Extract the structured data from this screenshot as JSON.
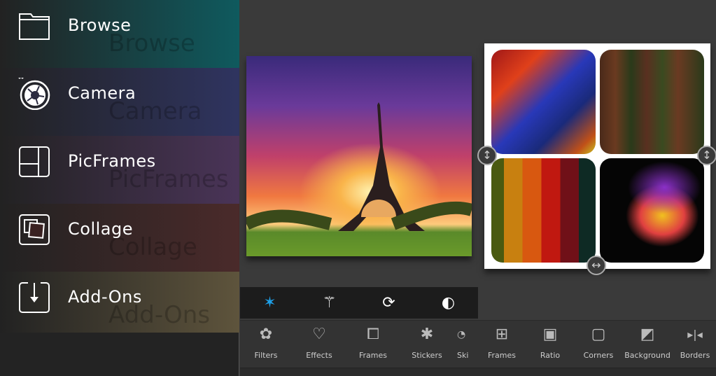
{
  "sidebar": {
    "items": [
      {
        "label": "Browse",
        "icon": "folder-icon",
        "color": "#0f5a5e"
      },
      {
        "label": "Camera",
        "icon": "camera-aperture-icon",
        "color": "#2f3460"
      },
      {
        "label": "PicFrames",
        "icon": "picframes-icon",
        "color": "#4a3458"
      },
      {
        "label": "Collage",
        "icon": "collage-icon",
        "color": "#4a2a2a"
      },
      {
        "label": "Add-Ons",
        "icon": "download-icon",
        "color": "#5e543c"
      }
    ]
  },
  "toolstrip": {
    "items": [
      {
        "icon": "sparkles-icon",
        "color": "#1ea0e8"
      },
      {
        "icon": "magic-wand-icon"
      },
      {
        "icon": "rotate-icon"
      },
      {
        "icon": "brightness-contrast-icon"
      }
    ]
  },
  "toolbar": {
    "items": [
      {
        "label": "Filters",
        "icon": "flower-icon"
      },
      {
        "label": "Effects",
        "icon": "heart-icon"
      },
      {
        "label": "Frames",
        "icon": "frame-star-icon"
      },
      {
        "label": "Stickers",
        "icon": "splat-icon"
      },
      {
        "label": "Ski",
        "icon": "sketch-icon"
      },
      {
        "label": "Frames",
        "icon": "picframes-icon"
      },
      {
        "label": "Ratio",
        "icon": "ratio-icon"
      },
      {
        "label": "Corners",
        "icon": "rounded-square-icon"
      },
      {
        "label": "Background",
        "icon": "paint-bucket-icon"
      },
      {
        "label": "Borders",
        "icon": "borders-icon"
      }
    ]
  }
}
